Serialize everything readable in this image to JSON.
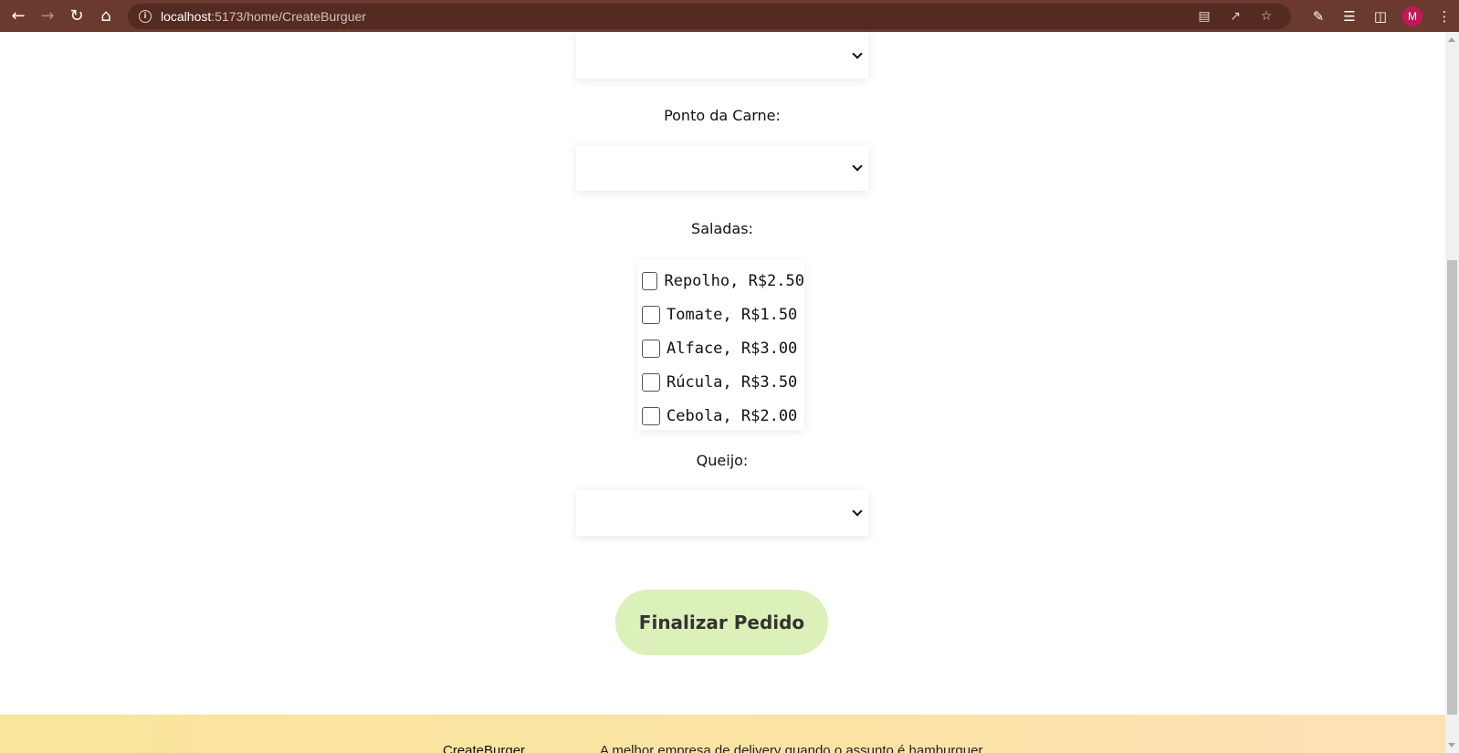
{
  "browser": {
    "url_host": "localhost",
    "url_path": ":5173/home/CreateBurguer",
    "profile_initial": "M",
    "icons": [
      "back-icon",
      "forward-icon",
      "reload-icon",
      "home-icon",
      "info-icon",
      "translate-icon",
      "share-icon",
      "star-icon",
      "extensions-icon",
      "reading-list-icon",
      "side-panel-icon",
      "menu-icon"
    ]
  },
  "form": {
    "ponto_label": "Ponto da Carne:",
    "saladas_label": "Saladas:",
    "queijo_label": "Queijo:",
    "saladas": [
      {
        "label": "Repolho, R$2.50",
        "checked": false
      },
      {
        "label": "Tomate, R$1.50",
        "checked": false
      },
      {
        "label": "Alface, R$3.00",
        "checked": false
      },
      {
        "label": "Rúcula, R$3.50",
        "checked": false
      },
      {
        "label": "Cebola, R$2.00",
        "checked": false
      }
    ],
    "submit_label": "Finalizar Pedido"
  },
  "footer": {
    "brand": "CreateBurger",
    "tagline": "A melhor empresa de delivery quando o assunto é hamburguer"
  },
  "colors": {
    "chrome": "#6b3a2e",
    "button": "#dcf0b9",
    "footer_start": "#f9e59b",
    "footer_end": "#fde2b6"
  }
}
